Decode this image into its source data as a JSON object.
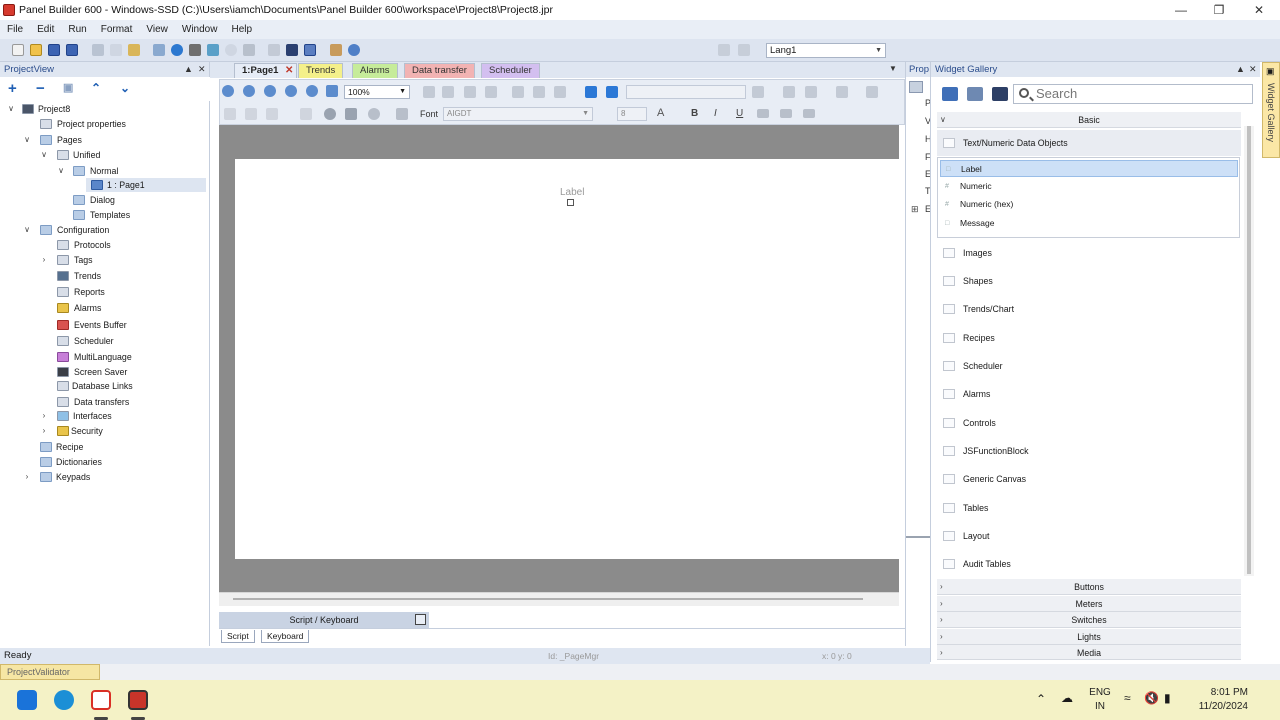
{
  "window": {
    "title": "Panel Builder 600 - Windows-SSD (C:)\\Users\\iamch\\Documents\\Panel Builder 600\\workspace\\Project8\\Project8.jpr",
    "controls": [
      "minimize-icon",
      "maximize-icon",
      "close-icon"
    ]
  },
  "menubar": [
    "File",
    "Edit",
    "Run",
    "Format",
    "View",
    "Window",
    "Help"
  ],
  "toolbar": {
    "language": "Lang1"
  },
  "project_view": {
    "title": "ProjectView",
    "actions": [
      "add-icon",
      "remove-icon",
      "copy-icon",
      "move-up-icon",
      "move-down-icon"
    ],
    "tree": [
      {
        "label": "Project8"
      },
      {
        "label": "Project properties"
      },
      {
        "label": "Pages"
      },
      {
        "label": "Unified"
      },
      {
        "label": "Normal"
      },
      {
        "label": "1 : Page1"
      },
      {
        "label": "Dialog"
      },
      {
        "label": "Templates"
      },
      {
        "label": "Configuration"
      },
      {
        "label": "Protocols"
      },
      {
        "label": "Tags"
      },
      {
        "label": "Trends"
      },
      {
        "label": "Reports"
      },
      {
        "label": "Alarms"
      },
      {
        "label": "Events Buffer"
      },
      {
        "label": "Scheduler"
      },
      {
        "label": "MultiLanguage"
      },
      {
        "label": "Screen Saver"
      },
      {
        "label": "Database Links"
      },
      {
        "label": "Data transfers"
      },
      {
        "label": "Interfaces"
      },
      {
        "label": "Security"
      },
      {
        "label": "Recipe"
      },
      {
        "label": "Dictionaries"
      },
      {
        "label": "Keypads"
      }
    ]
  },
  "doc_tabs": [
    {
      "label": "1:Page1",
      "color": "#e6ecf6"
    },
    {
      "label": "Trends",
      "color": "#f4f08a"
    },
    {
      "label": "Alarms",
      "color": "#c6ec9a"
    },
    {
      "label": "Data transfer",
      "color": "#f2b3b3"
    },
    {
      "label": "Scheduler",
      "color": "#d3bff0"
    }
  ],
  "editor": {
    "zoom": "100%",
    "font_label": "Font",
    "font_value": "AIGDT",
    "font_size": "8",
    "bold": "B",
    "italic": "I",
    "underline": "U",
    "canvas_label": "Label"
  },
  "script_panel": {
    "title": "Script / Keyboard",
    "tabs": [
      "Script",
      "Keyboard"
    ]
  },
  "properties": {
    "title": "Prop",
    "letters": [
      "P",
      "V",
      "H",
      "F",
      "E",
      "T",
      "E"
    ]
  },
  "widget_gallery": {
    "title": "Widget Gallery",
    "search_placeholder": "Search",
    "section_basic": "Basic",
    "group_title": "Text/Numeric Data Objects",
    "group_items": [
      "Label",
      "Numeric",
      "Numeric (hex)",
      "Message"
    ],
    "categories": [
      "Images",
      "Shapes",
      "Trends/Chart",
      "Recipes",
      "Scheduler",
      "Alarms",
      "Controls",
      "JSFunctionBlock",
      "Generic Canvas",
      "Tables",
      "Layout",
      "Audit Tables"
    ],
    "sections": [
      "Buttons",
      "Meters",
      "Switches",
      "Lights",
      "Media"
    ],
    "side_tab": "Widget Gallery"
  },
  "status": {
    "ready": "Ready",
    "id_field": "Id: _PageMgr",
    "coords": "x: 0    y: 0",
    "validator": "ProjectValidator"
  },
  "taskbar": {
    "apps": [
      "start-icon",
      "edge-icon",
      "abb-icon",
      "panel-builder-icon"
    ],
    "lang_top": "ENG",
    "lang_bottom": "IN",
    "time": "8:01 PM",
    "date": "11/20/2024"
  }
}
